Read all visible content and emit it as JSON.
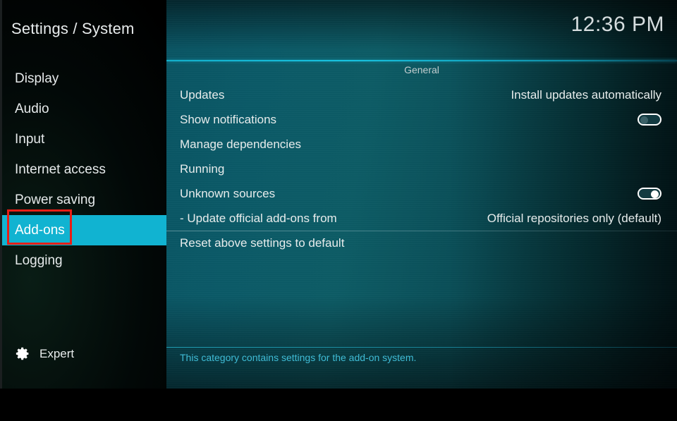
{
  "header": {
    "title": "Settings / System",
    "clock": "12:36 PM"
  },
  "sidebar": {
    "items": [
      {
        "label": "Display",
        "selected": false
      },
      {
        "label": "Audio",
        "selected": false
      },
      {
        "label": "Input",
        "selected": false
      },
      {
        "label": "Internet access",
        "selected": false
      },
      {
        "label": "Power saving",
        "selected": false
      },
      {
        "label": "Add-ons",
        "selected": true
      },
      {
        "label": "Logging",
        "selected": false
      }
    ],
    "expert": {
      "label": "Expert",
      "icon": "gear-icon"
    }
  },
  "main": {
    "group_title": "General",
    "settings": [
      {
        "label": "Updates",
        "value": "Install updates automatically",
        "control": "text",
        "separated": false
      },
      {
        "label": "Show notifications",
        "value": "off",
        "control": "toggle",
        "separated": false
      },
      {
        "label": "Manage dependencies",
        "value": "",
        "control": "none",
        "separated": false
      },
      {
        "label": "Running",
        "value": "",
        "control": "none",
        "separated": false
      },
      {
        "label": "Unknown sources",
        "value": "on",
        "control": "toggle",
        "separated": false
      },
      {
        "label": "- Update official add-ons from",
        "value": "Official repositories only (default)",
        "control": "text",
        "separated": false
      },
      {
        "label": "Reset above settings to default",
        "value": "",
        "control": "none",
        "separated": true
      }
    ],
    "footer_hint": "This category contains settings for the add-on system."
  },
  "annotation": {
    "target": "Add-ons",
    "color": "#e81d16"
  },
  "colors": {
    "accent": "#11b3d1",
    "hint_text": "#3fbcd6",
    "annotation": "#e81d16",
    "text": "#e7ecec"
  }
}
